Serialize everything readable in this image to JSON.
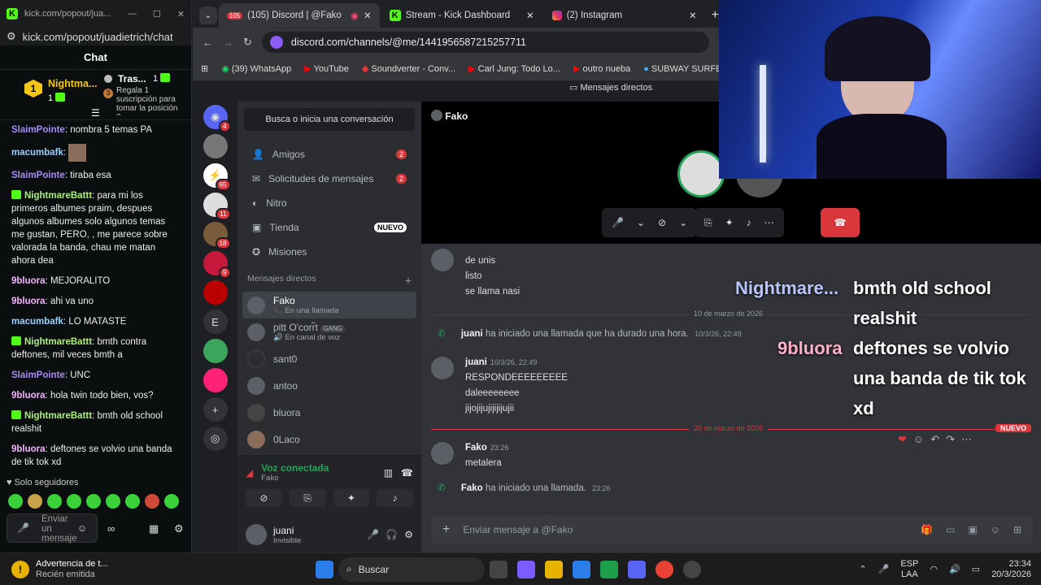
{
  "kick": {
    "tab_title": "kick.com/popout/jua...",
    "url": "kick.com/popout/juadietrich/chat",
    "chat_title": "Chat",
    "pinned_user1": "Nightma...",
    "pinned_count1": "1",
    "pinned_user2": "Tras...",
    "pinned_count2": "1",
    "gift_text": "Regala 1 suscripción para tomar la posición 3",
    "messages": [
      {
        "user": "SlaimPointe",
        "text": "nombra 5 temas PA"
      },
      {
        "user": "macumbafk",
        "text": ""
      },
      {
        "user": "SlaimPointe",
        "text": "tiraba esa"
      },
      {
        "user": "NightmareBattt",
        "text": "para mi los primeros albumes praim, despues algunos albumes solo algunos temas me gustan, PERO, , me parece sobre valorada la banda, chau me matan ahora dea"
      },
      {
        "user": "9bluora",
        "text": "MEJORALITO"
      },
      {
        "user": "9bluora",
        "text": "ahi va uno"
      },
      {
        "user": "macumbafk",
        "text": "LO MATASTE"
      },
      {
        "user": "NightmareBattt",
        "text": "bmth contra deftones, mil veces bmth a"
      },
      {
        "user": "SlaimPointe",
        "text": "UNC"
      },
      {
        "user": "9bluora",
        "text": "hola twin todo bien, vos?"
      },
      {
        "user": "NightmareBattt",
        "text": "bmth old school realshit"
      },
      {
        "user": "9bluora",
        "text": "deftones se volvio una banda de tik tok xd"
      }
    ],
    "followers_only": "Solo seguidores",
    "input_placeholder": "Enviar un mensaje"
  },
  "browser": {
    "tabs": [
      {
        "label": "(105) Discord | @Fako",
        "badge": "105"
      },
      {
        "label": "Stream - Kick Dashboard"
      },
      {
        "label": "(2) Instagram"
      }
    ],
    "url": "discord.com/channels/@me/1441956587215257711",
    "bookmarks": [
      "(39) WhatsApp",
      "YouTube",
      "Soundverter - Conv...",
      "Carl Jung: Todo Lo...",
      "outro nueba",
      "SUBWAY SURFE"
    ]
  },
  "discord": {
    "top_label": "Mensajes directos",
    "guild_badges": [
      "4",
      "65",
      "11",
      "18",
      "9"
    ],
    "guild_letter": "E",
    "search": "Busca o inicia una conversación",
    "nav": [
      {
        "label": "Amigos",
        "count": "2"
      },
      {
        "label": "Solicitudes de mensajes",
        "count": "2"
      },
      {
        "label": "Nitro",
        "count": ""
      },
      {
        "label": "Tienda",
        "count": "NUEVO"
      },
      {
        "label": "Misiones",
        "count": ""
      }
    ],
    "dm_header": "Mensajes directos",
    "dms": [
      {
        "name": "Fako",
        "sub": "En una llamada"
      },
      {
        "name": "pitt O'corr̃t",
        "sub": "En canal de voz",
        "tag": "GANG"
      },
      {
        "name": "sant0",
        "sub": ""
      },
      {
        "name": "antoo",
        "sub": ""
      },
      {
        "name": "bluora",
        "sub": ""
      },
      {
        "name": "0Laco",
        "sub": ""
      }
    ],
    "voice_status": "Voz conectada",
    "voice_channel": "Fako",
    "user_name": "juani",
    "user_status": "Invisible",
    "call_name": "Fako",
    "messages": {
      "m1_lines": [
        "de unis",
        "listo",
        "se llama nasi"
      ],
      "date1": "10 de marzo de 2026",
      "call1_user": "juani",
      "call1_text": "ha iniciado una llamada que ha durado una hora.",
      "call1_time": "10/3/26, 22:49",
      "m2_user": "juani",
      "m2_time": "10/3/26, 22:49",
      "m2_lines": [
        "RESPONDEEEEEEEEE",
        "daleeeeeeee",
        "jijojijujijijijujii"
      ],
      "date2": "20 de marzo de 2026",
      "new_label": "NUEVO",
      "m3_user": "Fako",
      "m3_time": "23:26",
      "m3_text": "metalera",
      "call2_user": "Fako",
      "call2_text": "ha iniciado una llamada.",
      "call2_time": "23:26"
    },
    "input_placeholder": "Enviar mensaje a @Fako"
  },
  "overlay": [
    {
      "user": "Nightmare...",
      "text": "bmth old school realshit"
    },
    {
      "user": "9bluora",
      "text": "deftones se volvio una banda de tik tok xd"
    }
  ],
  "taskbar": {
    "notif_title": "Advertencia de t...",
    "notif_sub": "Recién emitida",
    "search": "Buscar",
    "lang": "ESP",
    "lang2": "LAA",
    "time": "23:34",
    "date": "20/3/2026"
  },
  "colors": {
    "kick_green": "#53fc18",
    "discord_red": "#da373c",
    "discord_bg": "#313338"
  }
}
